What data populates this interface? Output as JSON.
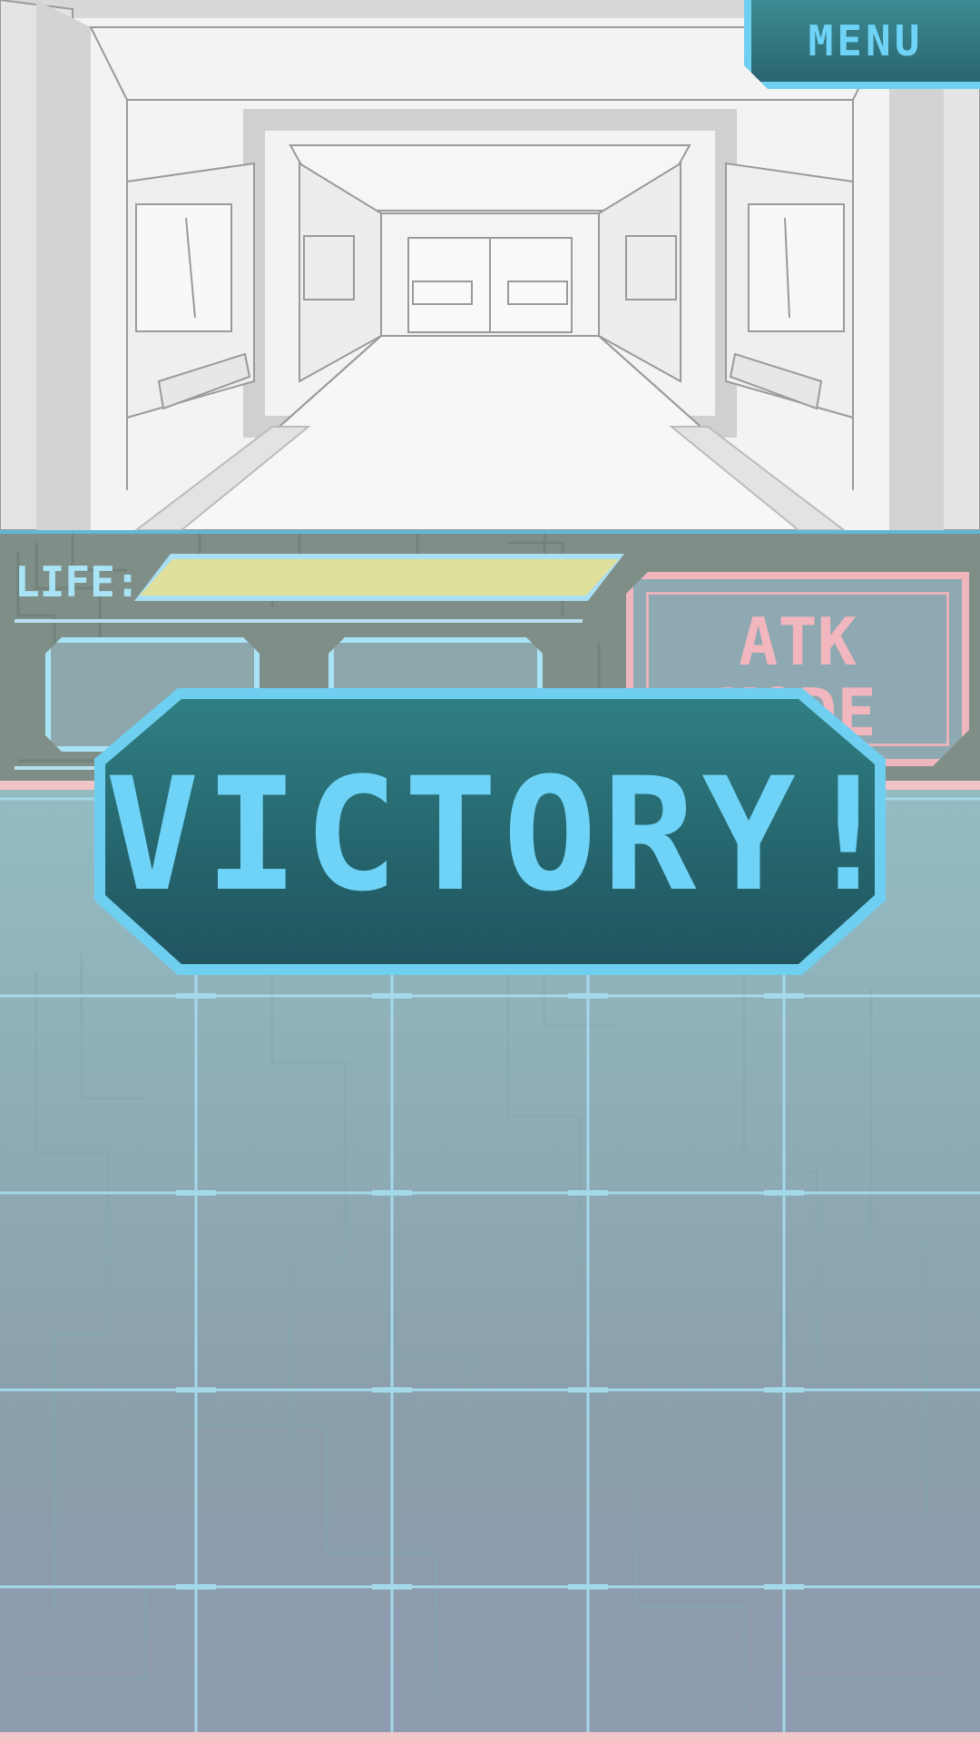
{
  "menu": {
    "label": "MENU"
  },
  "hud": {
    "life_label": "LIFE:",
    "life_fraction": 1.0,
    "atk_mode_label": "ATK\nMODE",
    "slots": [
      {
        "label": ""
      },
      {
        "label": ""
      }
    ]
  },
  "banner": {
    "text": "VICTORY!"
  },
  "board": {
    "columns": 5,
    "rows": 6
  },
  "colors": {
    "accent_cyan": "#6fd3f7",
    "life_fill": "#dfe09c",
    "atk_pink": "#f1b6be",
    "banner_bg": "#25646c"
  },
  "icons": [
    "corridor-scene",
    "circuit-pattern"
  ]
}
